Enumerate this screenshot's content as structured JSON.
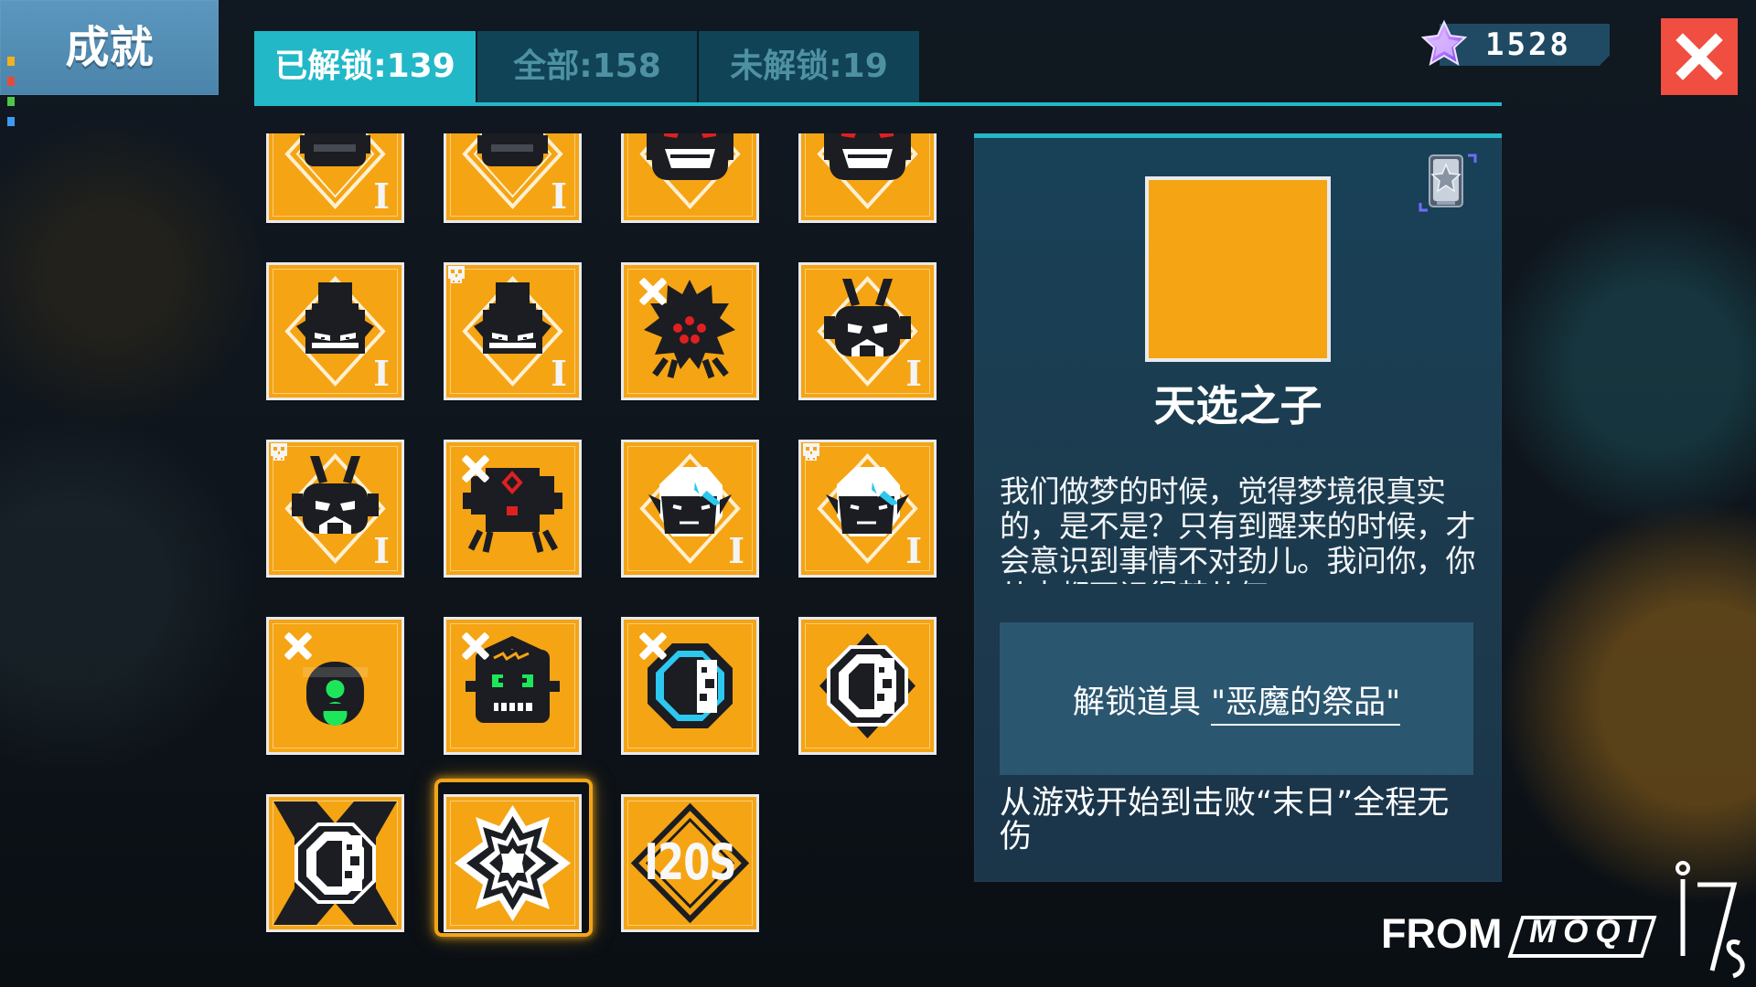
{
  "header": {
    "title": "成就",
    "tabs": [
      {
        "label": "已解锁:139"
      },
      {
        "label": "全部:158"
      },
      {
        "label": "未解锁:19"
      }
    ],
    "currency": {
      "value": "1528",
      "icon": "star-gem-icon"
    },
    "close_icon": "close-icon"
  },
  "achievements": [
    {
      "icon": "robot-visor-icon",
      "tier": "I",
      "locked": false,
      "skull": false,
      "row": 0,
      "col": 0
    },
    {
      "icon": "robot-visor-icon",
      "tier": "I",
      "locked": false,
      "skull": true,
      "row": 0,
      "col": 1
    },
    {
      "icon": "red-eyed-robot-icon",
      "tier": "",
      "locked": false,
      "skull": false,
      "row": 0,
      "col": 2
    },
    {
      "icon": "red-eyed-robot-icon",
      "tier": "",
      "locked": false,
      "skull": false,
      "row": 0,
      "col": 3
    },
    {
      "icon": "top-hat-face-icon",
      "tier": "I",
      "locked": false,
      "skull": false,
      "row": 1,
      "col": 0
    },
    {
      "icon": "top-hat-face-icon",
      "tier": "I",
      "locked": false,
      "skull": true,
      "row": 1,
      "col": 1
    },
    {
      "icon": "spiked-monster-icon",
      "tier": "",
      "locked": true,
      "skull": false,
      "row": 1,
      "col": 2
    },
    {
      "icon": "horned-helmet-icon",
      "tier": "I",
      "locked": false,
      "skull": false,
      "row": 1,
      "col": 3
    },
    {
      "icon": "horned-helmet-icon",
      "tier": "I",
      "locked": false,
      "skull": true,
      "row": 2,
      "col": 0
    },
    {
      "icon": "crab-mech-icon",
      "tier": "",
      "locked": true,
      "skull": false,
      "row": 2,
      "col": 1
    },
    {
      "icon": "white-hair-face-icon",
      "tier": "I",
      "locked": false,
      "skull": false,
      "row": 2,
      "col": 2
    },
    {
      "icon": "white-hair-face-icon",
      "tier": "I",
      "locked": false,
      "skull": true,
      "row": 2,
      "col": 3
    },
    {
      "icon": "green-mouth-bot-icon",
      "tier": "",
      "locked": true,
      "skull": false,
      "row": 3,
      "col": 0
    },
    {
      "icon": "frankenstein-face-icon",
      "tier": "",
      "locked": true,
      "skull": false,
      "row": 3,
      "col": 1
    },
    {
      "icon": "cyan-coin-icon",
      "tier": "",
      "locked": true,
      "skull": false,
      "row": 3,
      "col": 2
    },
    {
      "icon": "white-coin-diamond-icon",
      "tier": "",
      "locked": false,
      "skull": false,
      "row": 3,
      "col": 3
    },
    {
      "icon": "white-coin-x-icon",
      "tier": "",
      "locked": false,
      "skull": false,
      "row": 4,
      "col": 0
    },
    {
      "icon": "eight-point-star-icon",
      "tier": "",
      "locked": false,
      "skull": false,
      "selected": true,
      "row": 4,
      "col": 1
    },
    {
      "icon": "text-1205-icon",
      "label": "I20S",
      "tier": "",
      "locked": false,
      "skull": false,
      "row": 4,
      "col": 2
    }
  ],
  "details": {
    "icon": "eight-point-star-icon",
    "title": "天选之子",
    "story": "我们做梦的时候，觉得梦境很真实的，是不是？只有到醒来的时候，才会意识到事情不对劲儿。我问你，你从来都不记得梦从何",
    "unlock_prefix": "解锁道具",
    "unlock_item": "\"恶魔的祭品\"",
    "condition": "从游戏开始到击败“末日”全程无伤",
    "corner_badge_icon": "silver-star-badge-icon"
  },
  "watermark": {
    "from": "FROM",
    "brand": "MOQI"
  }
}
